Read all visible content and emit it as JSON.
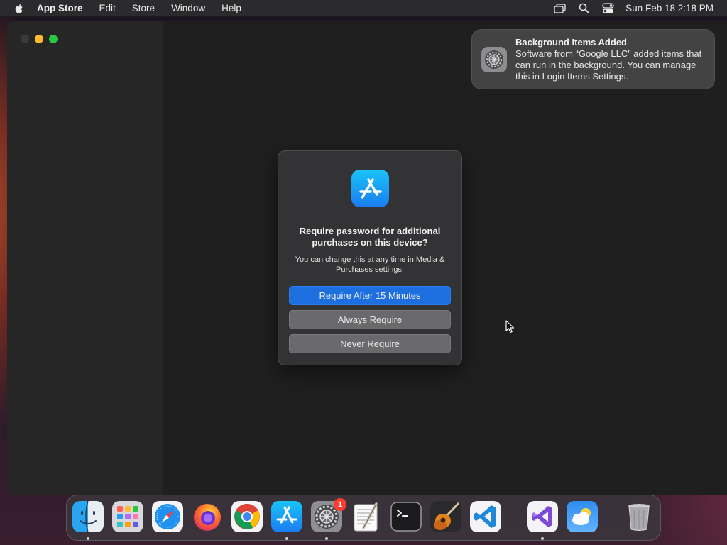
{
  "menubar": {
    "app_name": "App Store",
    "items": [
      "Edit",
      "Store",
      "Window",
      "Help"
    ],
    "clock": "Sun Feb 18  2:18 PM",
    "status_icons": [
      "screen-mirroring-icon",
      "spotlight-search-icon",
      "control-center-icon"
    ]
  },
  "notification": {
    "title": "Background Items Added",
    "body": "Software from “Google LLC” added items that can run in the background. You can manage this in Login Items Settings.",
    "icon": "system-settings-gear-icon"
  },
  "dialog": {
    "icon": "app-store-icon",
    "title": "Require password for additional purchases on this device?",
    "body": "You can change this at any time in Media & Purchases settings.",
    "buttons": {
      "primary": "Require After 15 Minutes",
      "always": "Always Require",
      "never": "Never Require"
    }
  },
  "dock": {
    "apps": [
      "Finder",
      "Launchpad",
      "Safari",
      "Firefox",
      "Google Chrome",
      "App Store",
      "System Settings",
      "TextEdit",
      "Terminal",
      "GarageBand",
      "Visual Studio Code",
      "Visual Studio",
      "Weather",
      "Trash"
    ],
    "badge": "1"
  },
  "colors": {
    "accent": "#1d6fe0",
    "menubar": "#2b2a2c",
    "dialog_bg": "#333335",
    "badge": "#ff3b30"
  }
}
